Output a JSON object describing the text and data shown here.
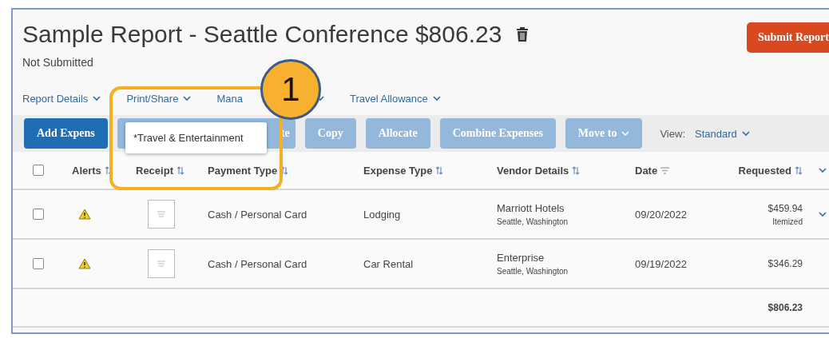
{
  "report": {
    "title": "Sample Report - Seattle Conference $806.23",
    "status": "Not Submitted",
    "submit_button": "Submit Report"
  },
  "nav": [
    {
      "label": "Report Details"
    },
    {
      "label": "Print/Share"
    },
    {
      "label": "Mana"
    },
    {
      "label": "Travel Allowance"
    }
  ],
  "toolbar": {
    "buttons": [
      {
        "label": "Add Expens",
        "disabled": false,
        "has_menu": false
      },
      {
        "label": "te",
        "disabled": true,
        "has_menu": false
      },
      {
        "label": "Copy",
        "disabled": true,
        "has_menu": false
      },
      {
        "label": "Allocate",
        "disabled": true,
        "has_menu": false
      },
      {
        "label": "Combine Expenses",
        "disabled": true,
        "has_menu": false
      },
      {
        "label": "Move to",
        "disabled": true,
        "has_menu": true
      }
    ],
    "view_label": "View:",
    "view_value": "Standard"
  },
  "dropdown": {
    "items": [
      "*Travel & Entertainment"
    ]
  },
  "callout": {
    "number": "1"
  },
  "table": {
    "header_checked": false,
    "columns": [
      {
        "label": "Alerts",
        "sorted": false
      },
      {
        "label": "Receipt",
        "sorted": false
      },
      {
        "label": "Payment Type",
        "sorted": false
      },
      {
        "label": "Expense Type",
        "sorted": false
      },
      {
        "label": "Vendor Details",
        "sorted": false
      },
      {
        "label": "Date",
        "sorted": true
      },
      {
        "label": "Requested",
        "sorted": false
      }
    ],
    "rows": [
      {
        "checked": false,
        "alert": true,
        "payment_type": "Cash / Personal Card",
        "expense_type": "Lodging",
        "vendor": "Marriott Hotels",
        "location": "Seattle, Washington",
        "date": "09/20/2022",
        "amount": "$459.94",
        "note": "Itemized",
        "expandable": true
      },
      {
        "checked": false,
        "alert": true,
        "payment_type": "Cash / Personal Card",
        "expense_type": "Car Rental",
        "vendor": "Enterprise",
        "location": "Seattle, Washington",
        "date": "09/19/2022",
        "amount": "$346.29",
        "expandable": false
      }
    ],
    "total": "$806.23"
  }
}
